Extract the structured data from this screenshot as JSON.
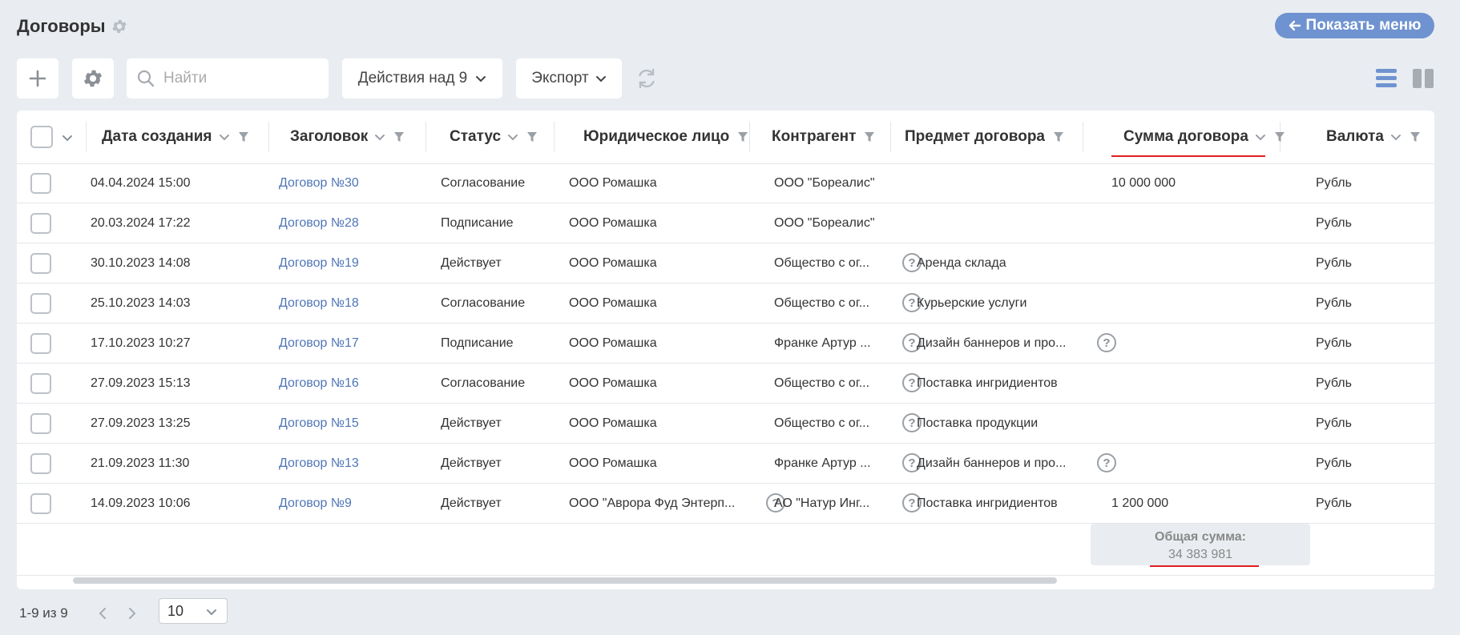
{
  "header": {
    "title": "Договоры",
    "show_menu_label": "Показать меню"
  },
  "toolbar": {
    "search_placeholder": "Найти",
    "actions_label": "Действия над 9",
    "export_label": "Экспорт"
  },
  "columns": [
    "Дата создания",
    "Заголовок",
    "Статус",
    "Юридическое лицо",
    "Контрагент",
    "Предмет договора",
    "Сумма договора",
    "Валюта"
  ],
  "rows": [
    {
      "date": "04.04.2024 15:00",
      "title": "Договор №30",
      "status": "Согласование",
      "entity": "ООО Ромашка",
      "entity_help": false,
      "counterparty": "ООО \"Бореалис\"",
      "cp_help": false,
      "subject": "",
      "subj_help": false,
      "amount": "10 000 000",
      "currency": "Рубль"
    },
    {
      "date": "20.03.2024 17:22",
      "title": "Договор №28",
      "status": "Подписание",
      "entity": "ООО Ромашка",
      "entity_help": false,
      "counterparty": "ООО \"Бореалис\"",
      "cp_help": false,
      "subject": "",
      "subj_help": false,
      "amount": "",
      "currency": "Рубль"
    },
    {
      "date": "30.10.2023 14:08",
      "title": "Договор №19",
      "status": "Действует",
      "entity": "ООО Ромашка",
      "entity_help": false,
      "counterparty": "Общество с ог...",
      "cp_help": true,
      "subject": "Аренда склада",
      "subj_help": false,
      "amount": "",
      "currency": "Рубль"
    },
    {
      "date": "25.10.2023 14:03",
      "title": "Договор №18",
      "status": "Согласование",
      "entity": "ООО Ромашка",
      "entity_help": false,
      "counterparty": "Общество с ог...",
      "cp_help": true,
      "subject": "Курьерские услуги",
      "subj_help": false,
      "amount": "",
      "currency": "Рубль"
    },
    {
      "date": "17.10.2023 10:27",
      "title": "Договор №17",
      "status": "Подписание",
      "entity": "ООО Ромашка",
      "entity_help": false,
      "counterparty": "Франке Артур ...",
      "cp_help": true,
      "subject": "Дизайн баннеров и про...",
      "subj_help": true,
      "amount": "",
      "currency": "Рубль"
    },
    {
      "date": "27.09.2023 15:13",
      "title": "Договор №16",
      "status": "Согласование",
      "entity": "ООО Ромашка",
      "entity_help": false,
      "counterparty": "Общество с ог...",
      "cp_help": true,
      "subject": "Поставка ингридиентов",
      "subj_help": false,
      "amount": "",
      "currency": "Рубль"
    },
    {
      "date": "27.09.2023 13:25",
      "title": "Договор №15",
      "status": "Действует",
      "entity": "ООО Ромашка",
      "entity_help": false,
      "counterparty": "Общество с ог...",
      "cp_help": true,
      "subject": "Поставка продукции",
      "subj_help": false,
      "amount": "",
      "currency": "Рубль"
    },
    {
      "date": "21.09.2023 11:30",
      "title": "Договор №13",
      "status": "Действует",
      "entity": "ООО Ромашка",
      "entity_help": false,
      "counterparty": "Франке Артур ...",
      "cp_help": true,
      "subject": "Дизайн баннеров и про...",
      "subj_help": true,
      "amount": "",
      "currency": "Рубль"
    },
    {
      "date": "14.09.2023 10:06",
      "title": "Договор №9",
      "status": "Действует",
      "entity": "ООО \"Аврора Фуд Энтерп...",
      "entity_help": true,
      "counterparty": "АО \"Натур Инг...",
      "cp_help": true,
      "subject": "Поставка ингридиентов",
      "subj_help": false,
      "amount": "1 200 000",
      "currency": "Рубль"
    }
  ],
  "total": {
    "label": "Общая сумма:",
    "value": "34 383 981"
  },
  "pager": {
    "range": "1-9 из 9",
    "page_size": "10"
  },
  "help_glyph": "?",
  "colors": {
    "accent": "#6f93d0",
    "link": "#4f76b8",
    "highlight": "#e21e1e",
    "background": "#e9edf1"
  }
}
